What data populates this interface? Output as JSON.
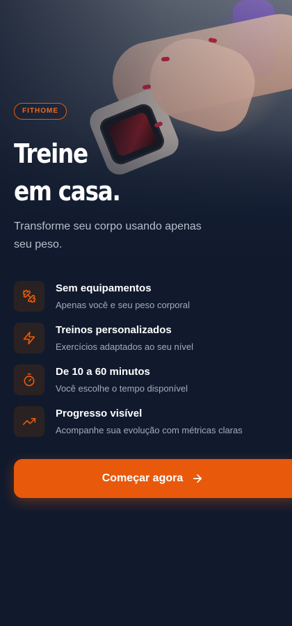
{
  "brand": {
    "label": "FITHOME"
  },
  "hero": {
    "title_line1": "Treine",
    "title_line2": "em casa.",
    "subtitle": "Transforme seu corpo usando apenas seu peso."
  },
  "features": [
    {
      "icon": "dumbbell-icon",
      "title": "Sem equipamentos",
      "description": "Apenas você e seu peso corporal"
    },
    {
      "icon": "lightning-icon",
      "title": "Treinos personalizados",
      "description": "Exercícios adaptados ao seu nível"
    },
    {
      "icon": "stopwatch-icon",
      "title": "De 10 a 60 minutos",
      "description": "Você escolhe o tempo disponível"
    },
    {
      "icon": "trending-up-icon",
      "title": "Progresso visível",
      "description": "Acompanhe sua evolução com métricas claras"
    }
  ],
  "cta": {
    "label": "Começar agora",
    "icon": "arrow-right-icon"
  },
  "colors": {
    "accent": "#e8590c",
    "background": "#111a2d",
    "icon_bg": "#2a2222"
  }
}
